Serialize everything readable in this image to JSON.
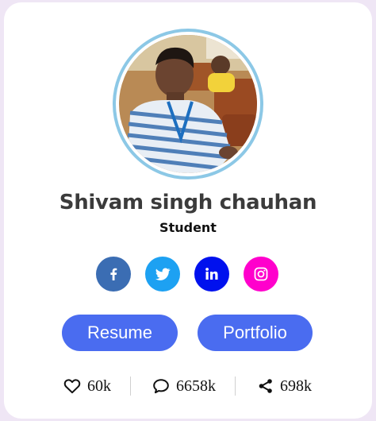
{
  "profile": {
    "name": "Shivam singh chauhan",
    "role": "Student"
  },
  "social": [
    {
      "icon": "facebook-icon",
      "color": "#3b6db3"
    },
    {
      "icon": "twitter-icon",
      "color": "#1da1f2"
    },
    {
      "icon": "linkedin-icon",
      "color": "#0011ee"
    },
    {
      "icon": "instagram-icon",
      "color": "#ff00cc"
    }
  ],
  "buttons": {
    "resume": "Resume",
    "portfolio": "Portfolio"
  },
  "stats": {
    "likes": "60k",
    "comments": "6658k",
    "shares": "698k"
  },
  "colors": {
    "accent": "#4a6cf0",
    "avatar_ring": "#8cc8e6",
    "page_background": "#efe6f5"
  }
}
